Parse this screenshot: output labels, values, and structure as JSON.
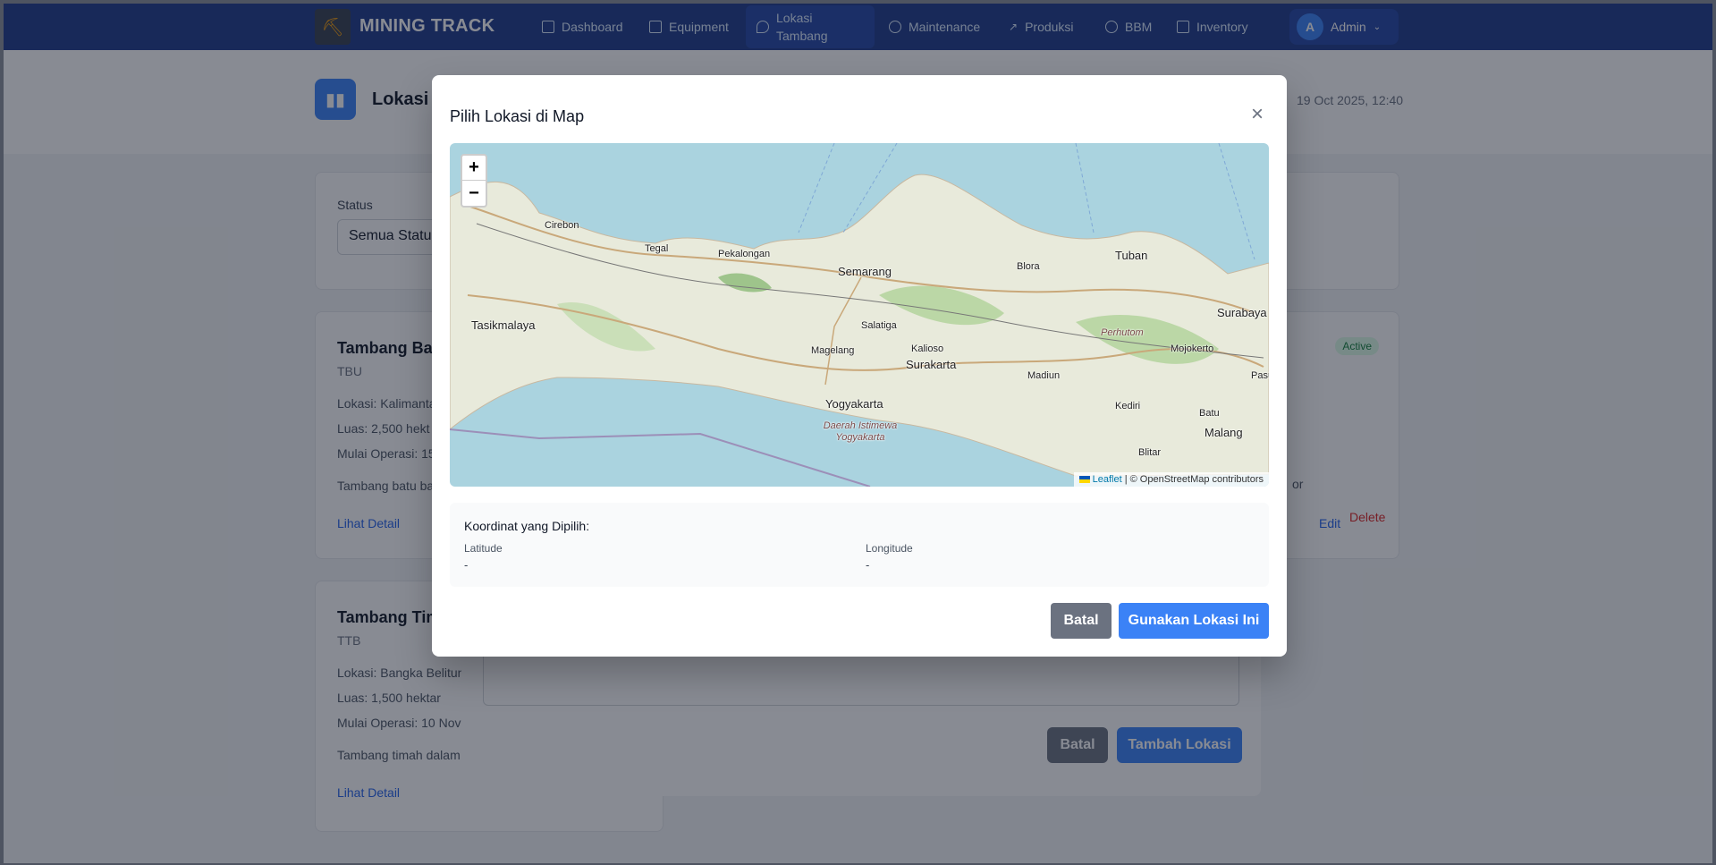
{
  "nav": {
    "brand": "MINING TRACK",
    "items": [
      {
        "label": "Dashboard",
        "icon": "dashboard-icon"
      },
      {
        "label": "Equipment",
        "icon": "equipment-icon"
      },
      {
        "label": "Lokasi Tambang",
        "icon": "location-pin-icon"
      },
      {
        "label": "Maintenance",
        "icon": "gear-icon"
      },
      {
        "label": "Produksi",
        "icon": "trend-icon"
      },
      {
        "label": "BBM",
        "icon": "fuel-icon"
      },
      {
        "label": "Inventory",
        "icon": "box-icon"
      }
    ],
    "user_initial": "A",
    "user_name": "Admin"
  },
  "header": {
    "title": "Lokasi T",
    "datetime": "19 Oct 2025, 12:40"
  },
  "filter": {
    "status_label": "Status",
    "status_value": "Semua Statu"
  },
  "mines": [
    {
      "name": "Tambang Bat",
      "code": "TBU",
      "lokasi": "Lokasi: Kalimanta",
      "luas": "Luas: 2,500 hekt",
      "mulai": "Mulai Operasi: 15",
      "desc": "Tambang batu ba",
      "desc_tail": "or",
      "status": "Active",
      "detail_link": "Lihat Detail",
      "edit": "Edit",
      "delete": "Delete"
    },
    {
      "name": "Tambang Tim",
      "code": "TTB",
      "lokasi": "Lokasi: Bangka Belitun",
      "luas": "Luas: 1,500 hektar",
      "mulai": "Mulai Operasi: 10 Nov",
      "desc": "Tambang timah dalam",
      "detail_link": "Lihat Detail"
    }
  ],
  "form": {
    "cancel_label": "Batal",
    "submit_label": "Tambah Lokasi"
  },
  "map_modal": {
    "title": "Pilih Lokasi di Map",
    "zoom_in": "+",
    "zoom_out": "−",
    "attribution_leaflet": "Leaflet",
    "attribution_rest": "| © OpenStreetMap contributors",
    "cities": [
      "Cirebon",
      "Tegal",
      "Pekalongan",
      "Semarang",
      "Blora",
      "Tuban",
      "Surabaya",
      "Tasikmalaya",
      "Salatiga",
      "Magelang",
      "Kalioso",
      "Surakarta",
      "Madiun",
      "Mojokerto",
      "Perhutom",
      "Yogyakarta",
      "Daerah Istimewa Yogyakarta",
      "Kediri",
      "Batu",
      "Malang",
      "Blitar",
      "Pasu"
    ],
    "coord_heading": "Koordinat yang Dipilih:",
    "latitude_label": "Latitude",
    "latitude_value": "-",
    "longitude_label": "Longitude",
    "longitude_value": "-",
    "cancel_label": "Batal",
    "use_label": "Gunakan Lokasi Ini"
  }
}
